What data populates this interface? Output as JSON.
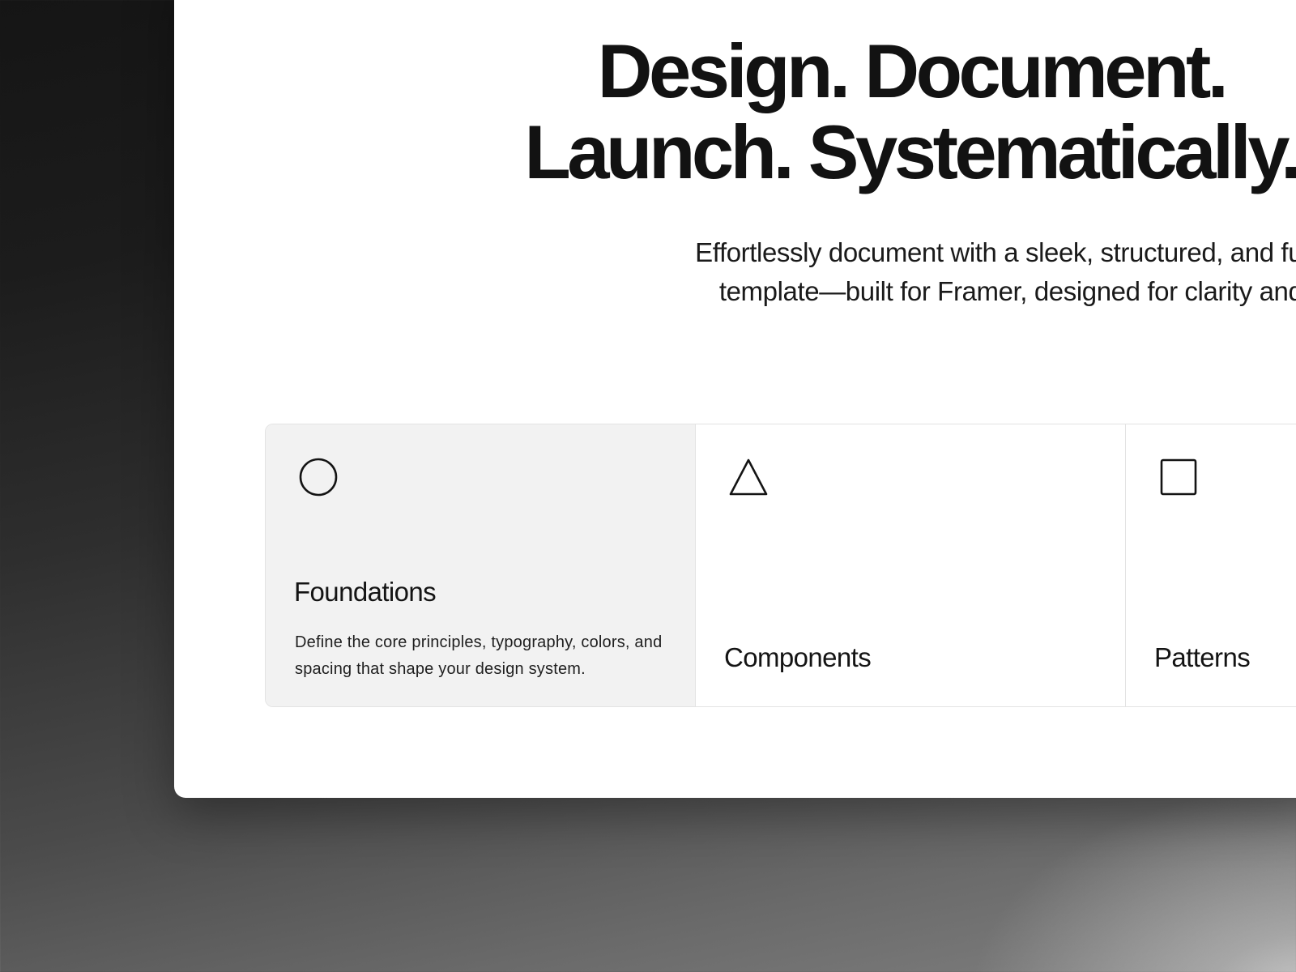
{
  "hero": {
    "headline_line1": "Design. Document.",
    "headline_line2": "Launch. Systematically.",
    "subtitle_line1": "Effortlessly document with a sleek, structured, and fully customiza",
    "subtitle_line2": "template—built for Framer, designed for clarity and scalability."
  },
  "cards": [
    {
      "icon": "circle-icon",
      "title": "Foundations",
      "description": "Define the core principles, typography, colors, and spacing that shape your design system.",
      "selected": true
    },
    {
      "icon": "triangle-icon",
      "title": "Components",
      "selected": false
    },
    {
      "icon": "square-icon",
      "title": "Patterns",
      "selected": false
    }
  ],
  "colors": {
    "text": "#121212",
    "card_active_bg": "#f2f2f2",
    "card_border": "#e3e3e3",
    "window_bg": "#ffffff"
  }
}
